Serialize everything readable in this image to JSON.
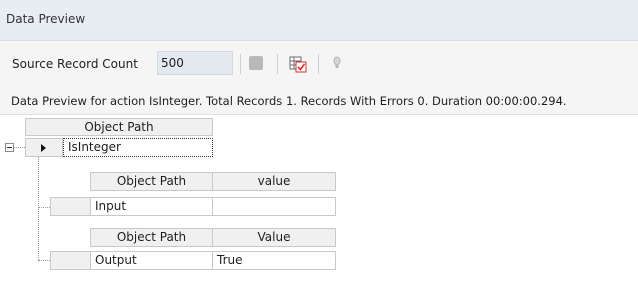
{
  "panel": {
    "title": "Data Preview"
  },
  "toolbar": {
    "source_label": "Source Record Count",
    "source_value": "500",
    "icons": {
      "stop": "stop-icon",
      "preview": "data-preview-check-icon",
      "bulb": "lightbulb-icon"
    }
  },
  "status": {
    "message": "Data Preview for action IsInteger. Total Records 1. Records With Errors 0. Duration 00:00:00.294."
  },
  "grid": {
    "root": {
      "header": "Object Path",
      "row_value": "IsInteger"
    },
    "input_table": {
      "headers": [
        "Object Path",
        "value"
      ],
      "rows": [
        [
          "Input",
          ""
        ]
      ]
    },
    "output_table": {
      "headers": [
        "Object Path",
        "Value"
      ],
      "rows": [
        [
          "Output",
          "True"
        ]
      ]
    }
  },
  "colors": {
    "titlebar_bg": "#e8edf4",
    "toolbar_bg": "#f5f5f5",
    "accent_red": "#d9312c"
  }
}
